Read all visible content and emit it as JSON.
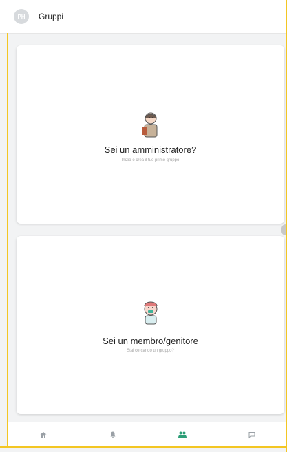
{
  "header": {
    "avatar_initials": "PH",
    "title": "Gruppi"
  },
  "cards": [
    {
      "title": "Sei un amministratore?",
      "subtitle": "Inizia e crea il tuo primo gruppo",
      "illustration": "admin-illustration"
    },
    {
      "title": "Sei un membro/genitore",
      "subtitle": "Stai cercando un gruppo?",
      "illustration": "member-illustration"
    }
  ],
  "bottom_nav": [
    {
      "name": "home",
      "icon": "home-icon",
      "active": false
    },
    {
      "name": "notifications",
      "icon": "bell-icon",
      "active": false
    },
    {
      "name": "groups",
      "icon": "groups-icon",
      "active": true
    },
    {
      "name": "messages",
      "icon": "chat-icon",
      "active": false
    }
  ],
  "colors": {
    "accent_gold": "#f3c623",
    "active_green": "#2d9e77",
    "inactive_icon": "#9aa0a6"
  }
}
